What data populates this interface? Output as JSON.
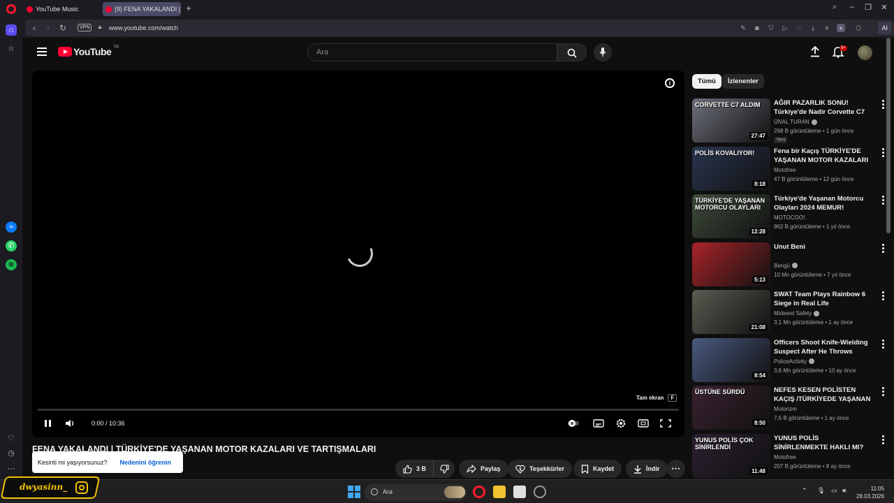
{
  "browser": {
    "tabs": [
      {
        "label": "YouTube Music"
      },
      {
        "label": "(9) FENA YAKALANDI | TÜ"
      }
    ],
    "vpn_label": "VPN",
    "url": "www.youtube.com/watch",
    "ai_label": "AI"
  },
  "header": {
    "logo_text": "YouTube",
    "country": "TR",
    "search_placeholder": "Ara",
    "notification_count": "9+"
  },
  "player": {
    "fullscreen_tip": "Tam ekran",
    "fullscreen_key": "F",
    "time": "0:00 / 10:36",
    "progress": 0
  },
  "video": {
    "title": "FENA YAKALANDI | TÜRKİYE'DE YAŞANAN MOTOR KAZALARI VE TARTIŞMALARI",
    "actions": {
      "likes": "3 B",
      "share": "Paylaş",
      "thanks": "Teşekkürler",
      "save": "Kaydet",
      "download": "İndir"
    }
  },
  "toast": {
    "text": "Kesinti mi yaşıyorsunuz?",
    "link": "Nedenini öğrenin"
  },
  "chips": [
    "Tümü",
    "İzlenenler"
  ],
  "recommendations": [
    {
      "title": "AĞIR PAZARLIK SONU! Türkiye'de Nadir Corvette C7 ...",
      "channel": "ÜNAL TURAN",
      "verified": true,
      "meta": "268 B görüntüleme • 1 gün önce",
      "duration": "27:47",
      "badge": "Yeni",
      "thumb_text": "CORVETTE C7 ALDIM",
      "thumb_color": "#6d6f7a"
    },
    {
      "title": "Fena bir Kaçış TÜRKİYE'DE YAŞANAN MOTOR KAZALARI ...",
      "channel": "Motofree",
      "verified": false,
      "meta": "47 B görüntüleme • 12 gün önce",
      "duration": "8:18",
      "badge": "",
      "thumb_text": "POLİS KOVALIYOR!",
      "thumb_color": "#2a3550"
    },
    {
      "title": "Türkiye'de Yaşanan Motorcu Olayları 2024 MEMUR!",
      "channel": "MOTOCOO!.",
      "verified": false,
      "meta": "962 B görüntüleme • 1 yıl önce",
      "duration": "12:28",
      "badge": "",
      "thumb_text": "TÜRKİYE'DE YAŞANAN MOTORCU OLAYLARI",
      "thumb_color": "#3d4a3a"
    },
    {
      "title": "Unut Beni",
      "channel": "Bengü",
      "verified": true,
      "meta": "10 Mn görüntüleme • 7 yıl önce",
      "duration": "5:13",
      "badge": "",
      "thumb_text": "",
      "thumb_color": "#a8242a"
    },
    {
      "title": "SWAT Team Plays Rainbow 6 Siege in Real Life",
      "channel": "Midwest Safety",
      "verified": true,
      "meta": "3,1 Mn görüntüleme • 1 ay önce",
      "duration": "21:08",
      "badge": "",
      "thumb_text": "",
      "thumb_color": "#5a5c52"
    },
    {
      "title": "Officers Shoot Knife-Wielding Suspect After He Throws Wine...",
      "channel": "PoliceActivity",
      "verified": true,
      "meta": "3,6 Mn görüntüleme • 10 ay önce",
      "duration": "8:54",
      "badge": "",
      "thumb_text": "",
      "thumb_color": "#4a5a80"
    },
    {
      "title": "NEFES KESEN POLİSTEN KAÇIŞ /TÜRKİYEDE YAŞANAN ...",
      "channel": "Motorizm",
      "verified": false,
      "meta": "7,6 B görüntüleme • 1 ay önce",
      "duration": "8:50",
      "badge": "",
      "thumb_text": "ÜSTÜNE SÜRDÜ",
      "thumb_color": "#3a2230"
    },
    {
      "title": "YUNUS POLİS SİNİRLENMEKTE HAKLI MI? TÜRKİYE'DE ...",
      "channel": "Motofree",
      "verified": false,
      "meta": "207 B görüntüleme • 8 ay önce",
      "duration": "11:48",
      "badge": "",
      "thumb_text": "YUNUS POLİS ÇOK SİNİRLENDİ",
      "thumb_color": "#2a2030"
    }
  ],
  "taskbar": {
    "search_placeholder": "Ara",
    "time": "11:05",
    "date": "28.03.2026"
  },
  "watermark": {
    "handle": "dwyasinn_"
  }
}
